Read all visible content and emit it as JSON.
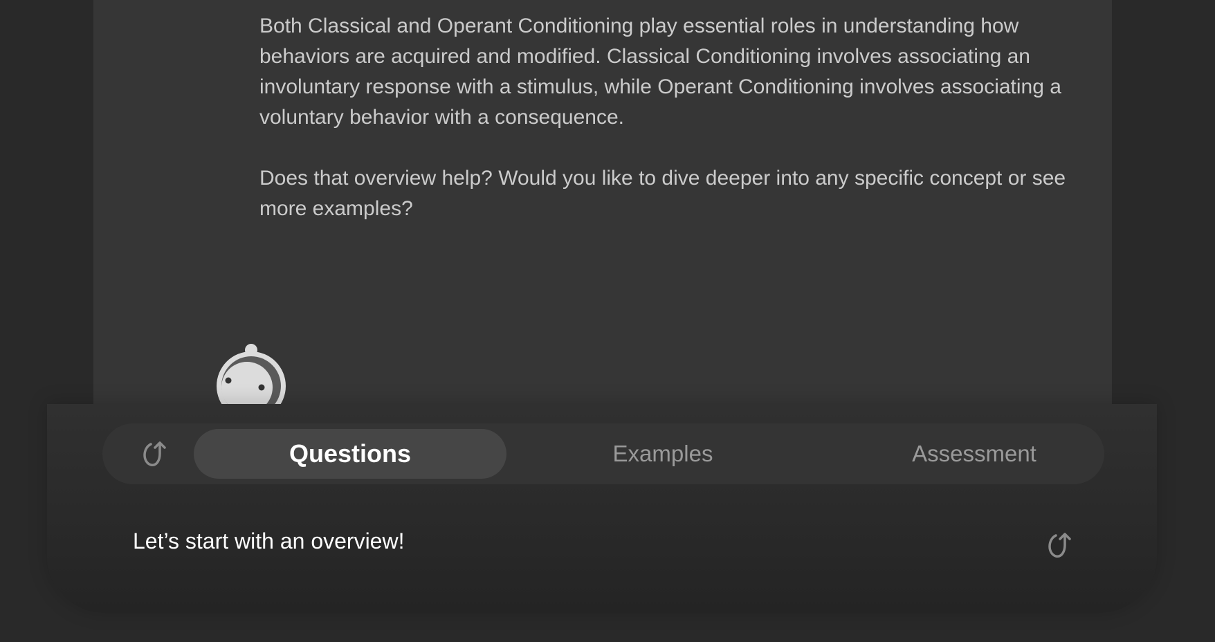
{
  "conversation": {
    "paragraphs": [
      "Both Classical and Operant Conditioning play essential roles in understanding how behaviors are acquired and modified. Classical Conditioning involves associating an involuntary response with a stimulus, while Operant Conditioning involves associating a voluntary behavior with a consequence.",
      "Does that overview help? Would you like to dive deeper into any specific concept or see more examples?"
    ],
    "avatar_icon": "robot-mascot-icon"
  },
  "mode_tabs": {
    "reset_icon": "rotate-arrow-icon",
    "items": [
      {
        "label": "Questions",
        "active": true
      },
      {
        "label": "Examples",
        "active": false
      },
      {
        "label": "Assessment",
        "active": false
      }
    ]
  },
  "composer": {
    "input_value": "Let’s start with an overview!",
    "send_icon": "upward-curve-arrow-icon"
  },
  "colors": {
    "background": "#292929",
    "panel": "#363636",
    "text": "#cbcbcb",
    "active_tab": "#464646",
    "inactive_tab_text": "#9a9a9a"
  }
}
